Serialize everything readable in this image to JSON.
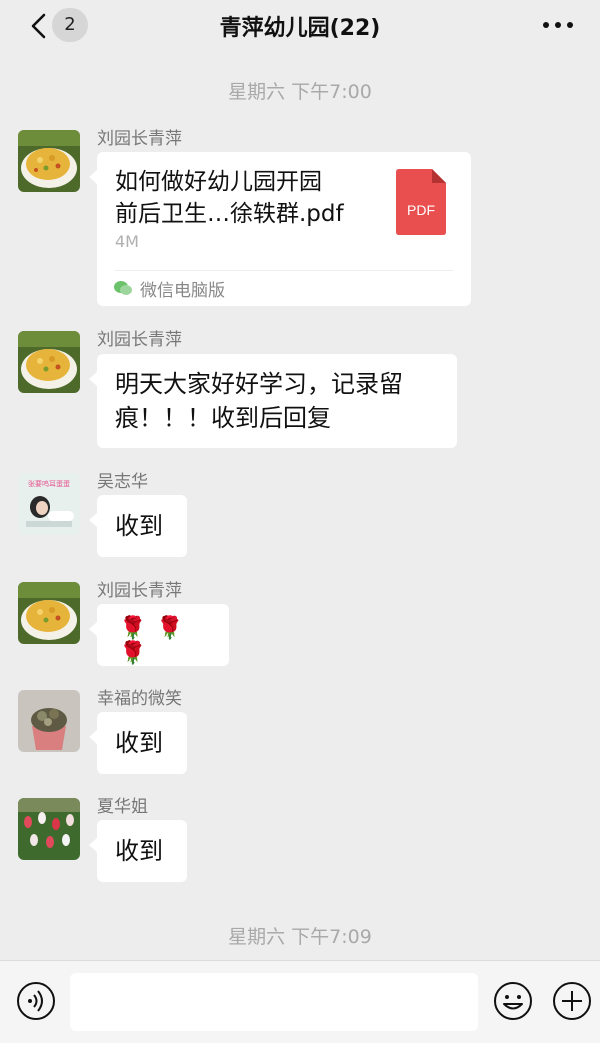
{
  "header": {
    "title": "青萍幼儿园(22)",
    "unread_count": "2",
    "back_icon": "chevron-left-icon",
    "more_icon": "more-dots-icon"
  },
  "times": [
    "星期六 下午7:00",
    "星期六 下午7:09"
  ],
  "messages": [
    {
      "sender": "刘园长青萍",
      "type": "file",
      "file_name": "如何做好幼儿园开园前后卫生…徐轶群.pdf",
      "file_name_lines": [
        "如何做好幼儿园开园",
        "前后卫生…徐轶群.pdf"
      ],
      "file_badge": "PDF",
      "file_size": "4M",
      "source": "微信电脑版"
    },
    {
      "sender": "刘园长青萍",
      "type": "text",
      "lines": [
        "明天大家好好学习，记录留",
        "痕！！！收到后回复"
      ]
    },
    {
      "sender": "吴志华",
      "type": "text",
      "text": "收到",
      "avatar_caption": "张要呜耳蛋蛋"
    },
    {
      "sender": "刘园长青萍",
      "type": "emoji",
      "text": "🌹🌹🌹"
    },
    {
      "sender": "幸福的微笑",
      "type": "text",
      "text": "收到"
    },
    {
      "sender": "夏华姐",
      "type": "text",
      "text": "收到"
    }
  ],
  "input_bar": {
    "voice_icon": "voice-icon",
    "emoji_icon": "emoji-icon",
    "plus_icon": "plus-icon"
  },
  "colors": {
    "background": "#ededed",
    "pdf_red": "#e94f4f",
    "bubble": "#ffffff",
    "time_text": "#a9a9a9"
  }
}
